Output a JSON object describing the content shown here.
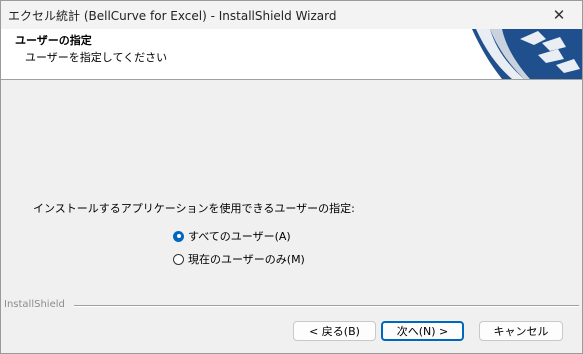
{
  "window": {
    "title": "エクセル統計 (BellCurve for Excel) - InstallShield Wizard",
    "close_glyph": "✕"
  },
  "header": {
    "title": "ユーザーの指定",
    "subtitle": "ユーザーを指定してください"
  },
  "body": {
    "prompt": "インストールするアプリケーションを使用できるユーザーの指定:",
    "options": [
      {
        "label": "すべてのユーザー(A)",
        "selected": true
      },
      {
        "label": "現在のユーザーのみ(M)",
        "selected": false
      }
    ]
  },
  "footer": {
    "brand": "InstallShield",
    "buttons": {
      "back": "< 戻る(B)",
      "next": "次へ(N) >",
      "cancel": "キャンセル"
    }
  },
  "colors": {
    "accent": "#0067c0",
    "logo_blue": "#1f4f8c"
  },
  "icons": {
    "close": "close-icon",
    "logo": "installshield-logo-icon",
    "radio_selected": "radio-checked-icon",
    "radio_unselected": "radio-unchecked-icon"
  }
}
